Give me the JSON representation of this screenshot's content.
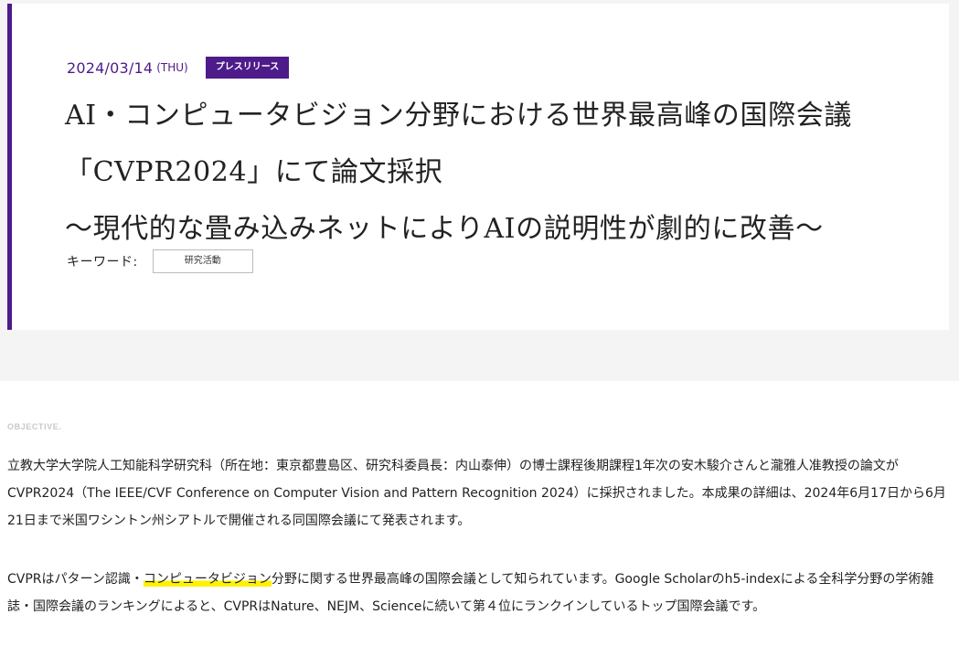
{
  "header": {
    "date": "2024/03/14",
    "weekday": "(THU)",
    "category": "プレスリリース",
    "title_lines": [
      "AI・コンピュータビジョン分野における世界最高峰の国際会議",
      "「CVPR2024」にて論文採択",
      "〜現代的な畳み込みネットによりAIの説明性が劇的に改善〜"
    ],
    "keyword_label": "キーワード:",
    "keyword_tag": "研究活動"
  },
  "body": {
    "section_label": "OBJECTIVE.",
    "paragraph1": "立教大学大学院人工知能科学研究科（所在地：東京都豊島区、研究科委員長：内山泰伸）の博士課程後期課程1年次の安木駿介さんと瀧雅人准教授の論文がCVPR2024（The IEEE/CVF Conference on Computer Vision and Pattern Recognition 2024）に採択されました。本成果の詳細は、2024年6月17日から6月21日まで米国ワシントン州シアトルで開催される同国際会議にて発表されます。",
    "paragraph2_before": "CVPRはパターン認識・",
    "paragraph2_highlight": "コンピュータビジョン",
    "paragraph2_after": "分野に関する世界最高峰の国際会議として知られています。Google Scholarのh5-indexによる全科学分野の学術雑誌・国際会議のランキングによると、CVPRはNature、NEJM、Scienceに続いて第４位にランクインしているトップ国際会議です。"
  },
  "colors": {
    "accent": "#4e1b8a",
    "highlight": "#fff200",
    "band_background": "#f4f4f4"
  }
}
